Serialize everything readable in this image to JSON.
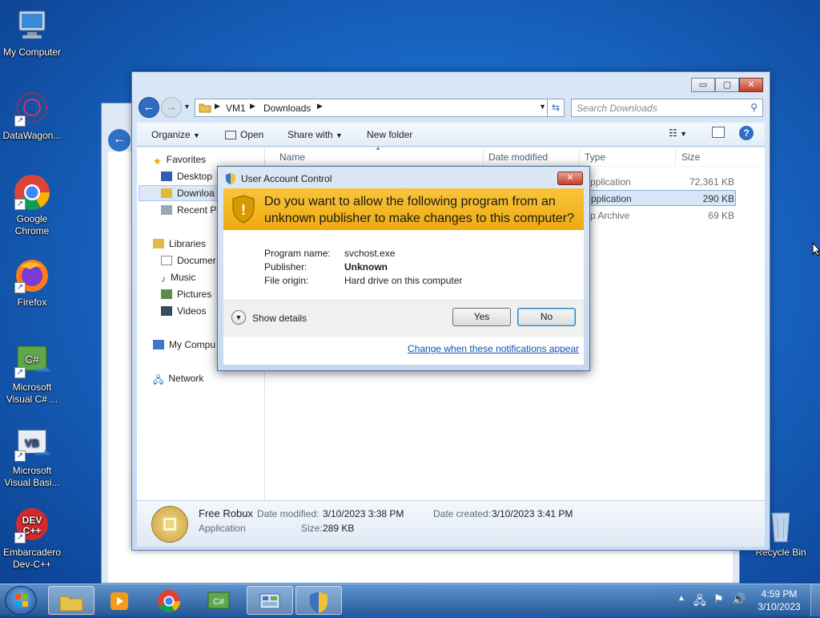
{
  "desktop": {
    "icons": [
      {
        "label": "My Computer"
      },
      {
        "label": "DataWagon..."
      },
      {
        "label": "Google Chrome"
      },
      {
        "label": "Firefox"
      },
      {
        "label": "Microsoft Visual C# ..."
      },
      {
        "label": "Microsoft Visual Basi..."
      },
      {
        "label": "Embarcadero Dev-C++"
      },
      {
        "label": "Recycle Bin"
      }
    ]
  },
  "explorer": {
    "caption_buttons": {
      "minimize": "▭",
      "maximize": "▢",
      "close": "✕"
    },
    "address": {
      "crumbs": [
        "VM1",
        "Downloads"
      ]
    },
    "search_placeholder": "Search Downloads",
    "toolbar": {
      "organize": "Organize",
      "open": "Open",
      "share_with": "Share with",
      "new_folder": "New folder"
    },
    "nav": {
      "favorites": "Favorites",
      "desktop": "Desktop",
      "downloads": "Downloa",
      "recent": "Recent Pl",
      "libraries": "Libraries",
      "documents": "Documer",
      "music": "Music",
      "pictures": "Pictures",
      "videos": "Videos",
      "my_computer": "My Compu",
      "network": "Network"
    },
    "columns": {
      "name": "Name",
      "date_modified": "Date modified",
      "type": "Type",
      "size": "Size"
    },
    "rows": [
      {
        "type": "pplication",
        "size": "72,361 KB"
      },
      {
        "type": "pplication",
        "size": "290 KB"
      },
      {
        "type": "p Archive",
        "size": "69 KB"
      }
    ],
    "details": {
      "name": "Free Robux",
      "type": "Application",
      "date_modified_label": "Date modified:",
      "date_modified": "3/10/2023 3:38 PM",
      "date_created_label": "Date created:",
      "date_created": "3/10/2023 3:41 PM",
      "size_label": "Size:",
      "size": "289 KB"
    }
  },
  "uac": {
    "title": "User Account Control",
    "question_line1": "Do you want to allow the following program from an",
    "question_line2": "unknown publisher to make changes to this computer?",
    "program_name_label": "Program name:",
    "program_name": "svchost.exe",
    "publisher_label": "Publisher:",
    "publisher": "Unknown",
    "file_origin_label": "File origin:",
    "file_origin": "Hard drive on this computer",
    "show_details": "Show details",
    "yes": "Yes",
    "no": "No",
    "change_link": "Change when these notifications appear"
  },
  "taskbar": {
    "time": "4:59 PM",
    "date": "3/10/2023"
  }
}
